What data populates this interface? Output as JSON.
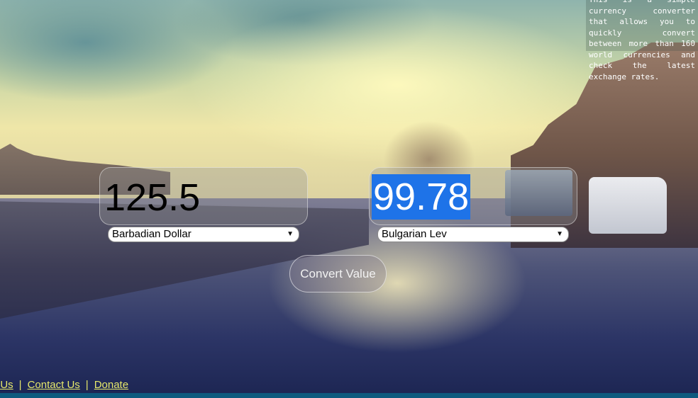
{
  "info": {
    "text": "This is a simple currency converter that allows you to quickly convert between more than 160 world currencies and check the latest exchange rates."
  },
  "converter": {
    "from": {
      "amount": "125.5",
      "currency": "Barbadian Dollar"
    },
    "to": {
      "amount": "99.78",
      "currency": "Bulgarian Lev"
    },
    "convert_label": "Convert Value"
  },
  "footer": {
    "links": [
      "t Us",
      "Contact Us",
      "Donate"
    ],
    "separator": "|"
  },
  "icons": {
    "dropdown": "chevron-down-icon"
  },
  "colors": {
    "selection": "#1e73e8",
    "footer_link": "#e6e86b"
  }
}
